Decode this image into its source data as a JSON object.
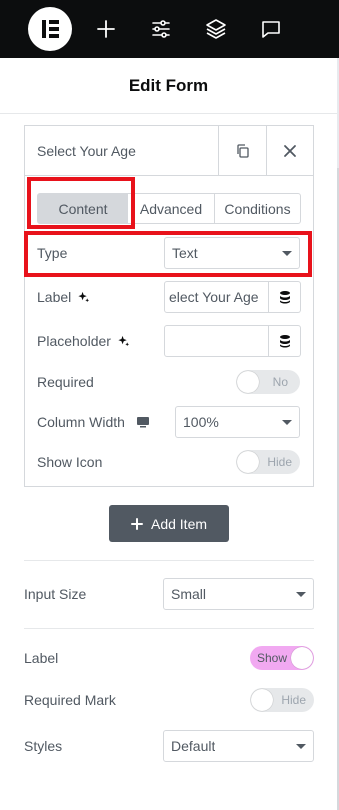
{
  "colors": {
    "topbar": "#0c0d0e",
    "highlight": "#e8121b",
    "toggle_on": "#f1a9f1",
    "button": "#515962"
  },
  "topbar": {
    "icons": [
      "elementor-logo",
      "plus-icon",
      "sliders-icon",
      "layers-icon",
      "chat-icon"
    ]
  },
  "panel": {
    "title": "Edit Form"
  },
  "item": {
    "title": "Select Your Age",
    "tabs": {
      "content": "Content",
      "advanced": "Advanced",
      "conditions": "Conditions"
    },
    "fields": {
      "type": {
        "label": "Type",
        "value": "Text"
      },
      "label": {
        "label": "Label",
        "value": "elect Your Age"
      },
      "placeholder": {
        "label": "Placeholder",
        "value": ""
      },
      "required": {
        "label": "Required",
        "toggle": "No",
        "on": false
      },
      "column_width": {
        "label": "Column Width",
        "value": "100%"
      },
      "show_icon": {
        "label": "Show Icon",
        "toggle": "Hide",
        "on": false
      }
    }
  },
  "add_item": {
    "label": "Add Item"
  },
  "settings": {
    "input_size": {
      "label": "Input Size",
      "value": "Small"
    },
    "label": {
      "label": "Label",
      "toggle": "Show",
      "on": true
    },
    "required_mark": {
      "label": "Required Mark",
      "toggle": "Hide",
      "on": false
    },
    "styles": {
      "label": "Styles",
      "value": "Default"
    }
  }
}
